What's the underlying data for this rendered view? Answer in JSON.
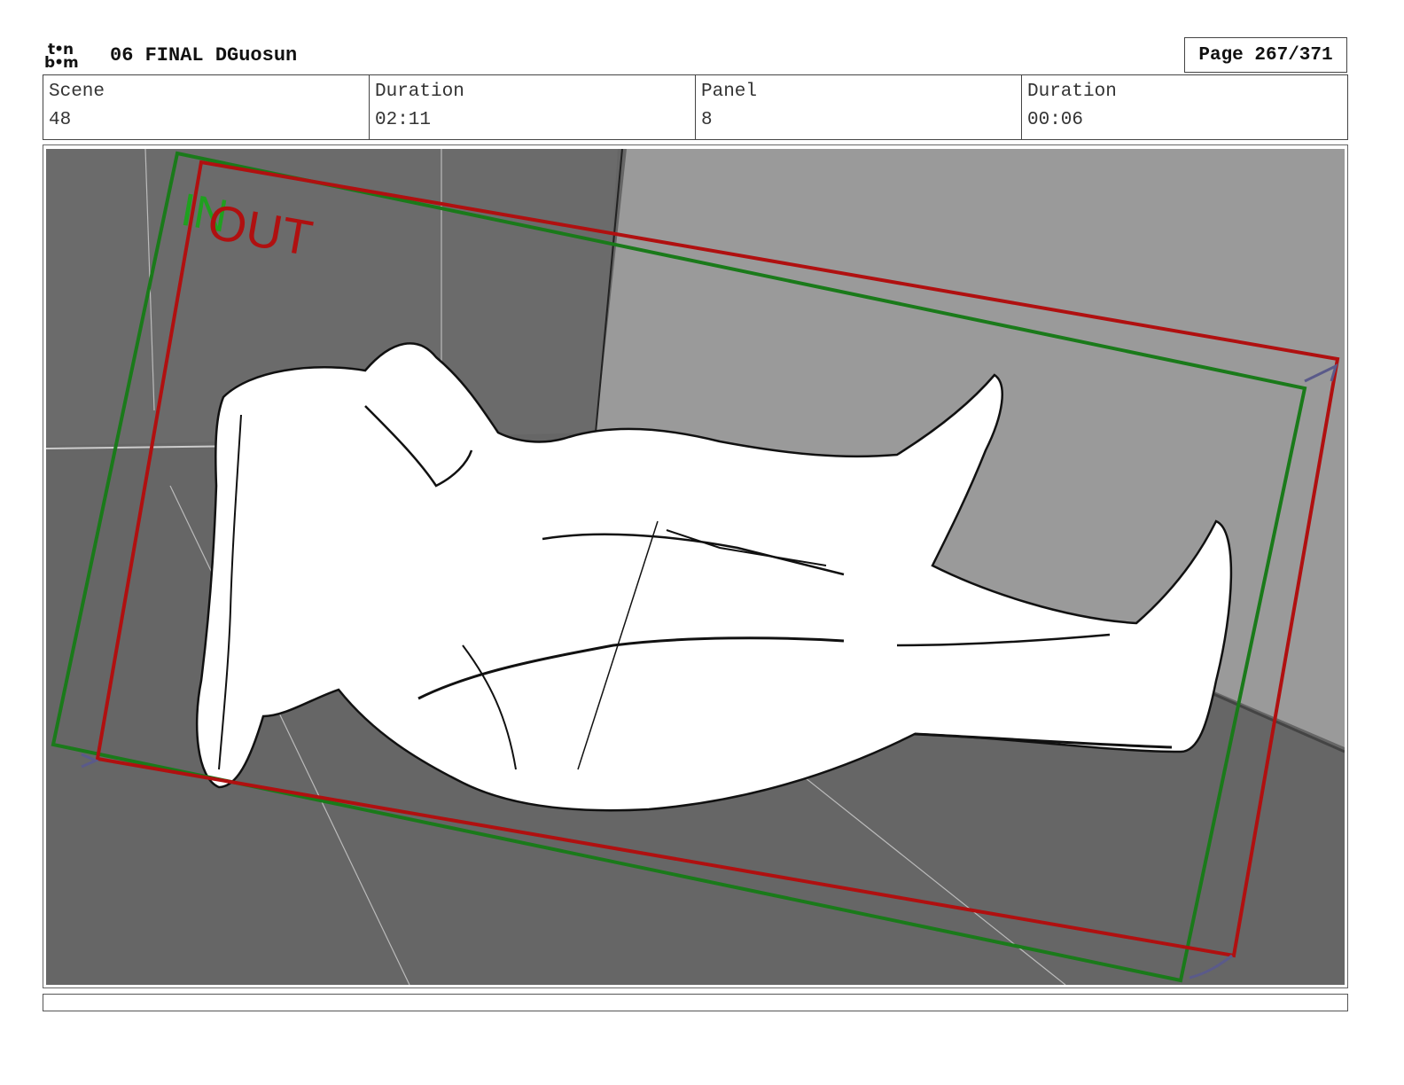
{
  "header": {
    "logo_line1": "t•n",
    "logo_line2": "b•m",
    "project_title": "06 FINAL DGuosun",
    "page_label": "Page 267/371"
  },
  "info": {
    "scene_label": "Scene",
    "scene_value": "48",
    "scene_duration_label": "Duration",
    "scene_duration_value": "02:11",
    "panel_label": "Panel",
    "panel_value": "8",
    "panel_duration_label": "Duration",
    "panel_duration_value": "00:06"
  },
  "panel": {
    "in_label": "IN",
    "out_label": "OUT",
    "in_color": "#1a7a1a",
    "out_color": "#b01010",
    "background_dark": "#666666",
    "wall_light": "#999999"
  }
}
